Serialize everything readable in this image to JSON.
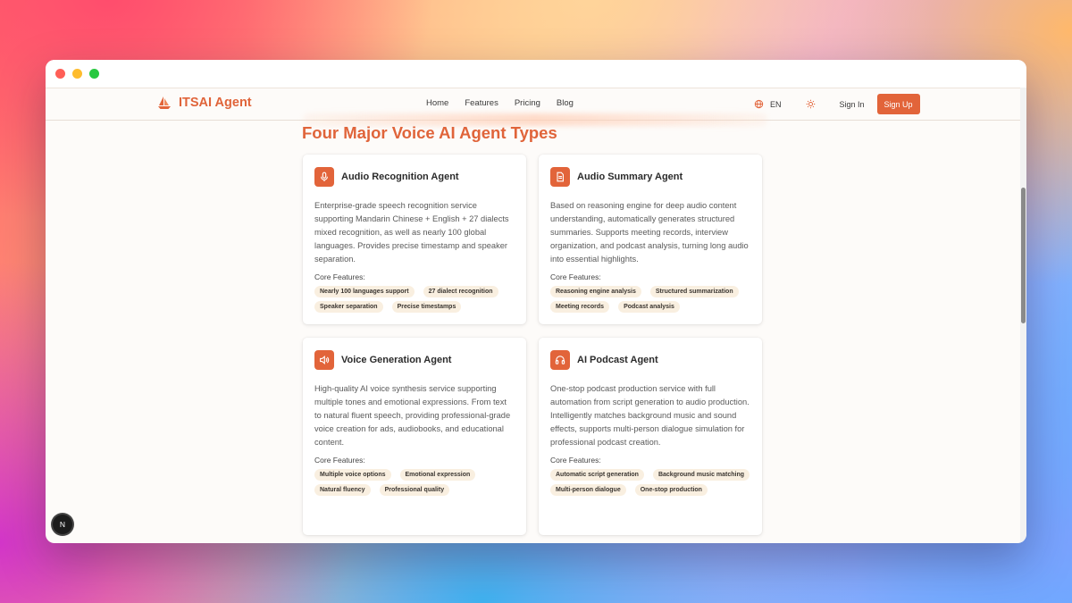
{
  "window": {
    "controls": [
      "close",
      "minimize",
      "maximize"
    ]
  },
  "navbar": {
    "brand": "ITSAI Agent",
    "logo_icon": "sailboat-logo-icon",
    "links": [
      "Home",
      "Features",
      "Pricing",
      "Blog"
    ],
    "language_icon": "globe-icon",
    "language": "EN",
    "theme_icon": "sun-icon",
    "sign_in": "Sign In",
    "sign_up": "Sign Up"
  },
  "section": {
    "title": "Four Major Voice AI Agent Types"
  },
  "cards": [
    {
      "icon": "microphone-icon",
      "title": "Audio Recognition Agent",
      "description": "Enterprise-grade speech recognition service supporting Mandarin Chinese + English + 27 dialects mixed recognition, as well as nearly 100 global languages. Provides precise timestamp and speaker separation.",
      "core_label": "Core Features:",
      "tags": [
        "Nearly 100 languages support",
        "27 dialect recognition",
        "Speaker separation",
        "Precise timestamps"
      ]
    },
    {
      "icon": "document-icon",
      "title": "Audio Summary Agent",
      "description": "Based on reasoning engine for deep audio content understanding, automatically generates structured summaries. Supports meeting records, interview organization, and podcast analysis, turning long audio into essential highlights.",
      "core_label": "Core Features:",
      "tags": [
        "Reasoning engine analysis",
        "Structured summarization",
        "Meeting records",
        "Podcast analysis"
      ]
    },
    {
      "icon": "speaker-icon",
      "title": "Voice Generation Agent",
      "description": "High-quality AI voice synthesis service supporting multiple tones and emotional expressions. From text to natural fluent speech, providing professional-grade voice creation for ads, audiobooks, and educational content.",
      "core_label": "Core Features:",
      "tags": [
        "Multiple voice options",
        "Emotional expression",
        "Natural fluency",
        "Professional quality"
      ]
    },
    {
      "icon": "headphones-icon",
      "title": "AI Podcast Agent",
      "description": "One-stop podcast production service with full automation from script generation to audio production. Intelligently matches background music and sound effects, supports multi-person dialogue simulation for professional podcast creation.",
      "core_label": "Core Features:",
      "tags": [
        "Automatic script generation",
        "Background music matching",
        "Multi-person dialogue",
        "One-stop production"
      ]
    }
  ],
  "dev_badge": "N",
  "colors": {
    "accent": "#e2643a",
    "tag_bg": "#f9efe0",
    "page_bg": "#fdfbf9"
  }
}
